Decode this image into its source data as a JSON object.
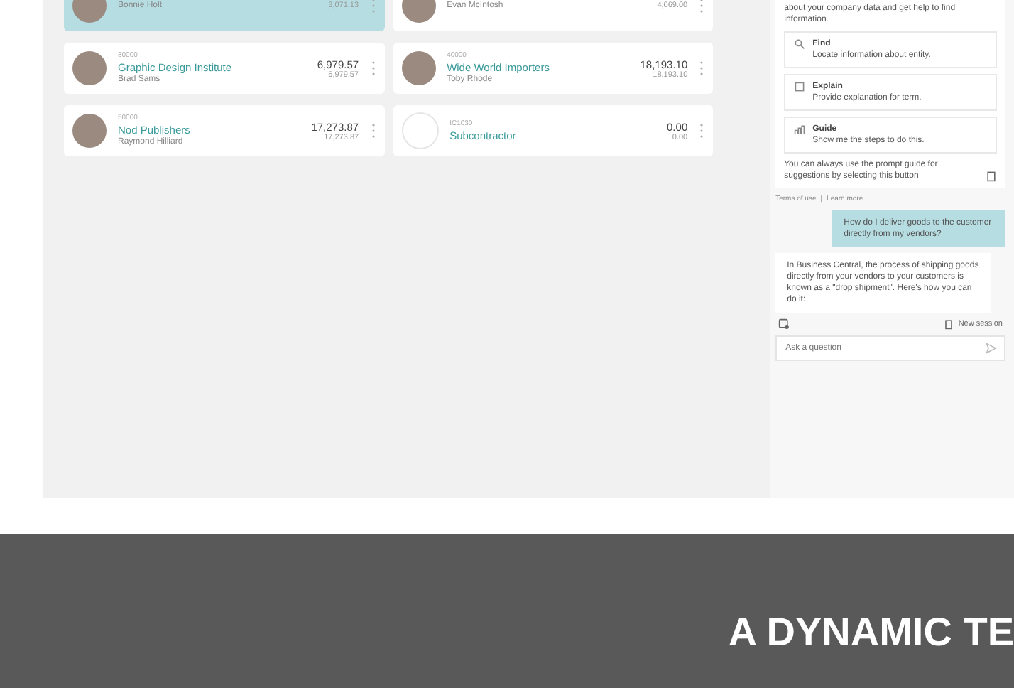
{
  "customers": [
    {
      "contact": "Bonnie Holt",
      "sub_amount": "3,071.13",
      "selected": true,
      "kind": "photo"
    },
    {
      "contact": "Evan McIntosh",
      "sub_amount": "4,069.00",
      "selected": false,
      "kind": "photo"
    },
    {
      "code": "30000",
      "name": "Graphic Design Institute",
      "contact": "Brad Sams",
      "amount": "6,979.57",
      "sub_amount": "6,979.57",
      "selected": false,
      "kind": "photo"
    },
    {
      "code": "40000",
      "name": "Wide World Importers",
      "contact": "Toby Rhode",
      "amount": "18,193.10",
      "sub_amount": "18,193.10",
      "selected": false,
      "kind": "photo"
    },
    {
      "code": "50000",
      "name": "Nod Publishers",
      "contact": "Raymond Hilliard",
      "amount": "17,273.87",
      "sub_amount": "17,273.87",
      "selected": false,
      "kind": "photo"
    },
    {
      "code": "IC1030",
      "name": "Subcontractor",
      "amount": "0.00",
      "sub_amount": "0.00",
      "selected": false,
      "kind": "blank"
    }
  ],
  "chat": {
    "intro": "about your company data and get help to find information.",
    "prompts": [
      {
        "title": "Find",
        "text": "Locate information about entity."
      },
      {
        "title": "Explain",
        "text": "Provide explanation for term."
      },
      {
        "title": "Guide",
        "text": "Show me the steps to do this."
      }
    ],
    "hint": "You can always use the prompt guide for suggestions by selecting this button",
    "terms": "Terms of use",
    "separator": "|",
    "learn": "Learn more",
    "user_message": "How do I deliver goods to the customer directly from my vendors?",
    "reply": "In Business Central, the process of shipping goods directly from your vendors to your customers is known as a \"drop shipment\". Here's how you can do it:",
    "new_session": "New session",
    "placeholder": "Ask a question"
  },
  "banner": {
    "heading": "A DYNAMIC TE"
  }
}
